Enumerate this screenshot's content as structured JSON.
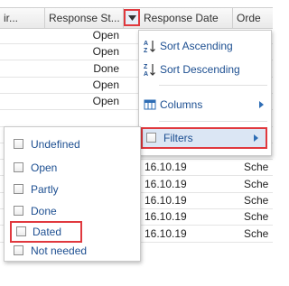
{
  "grid": {
    "columns": [
      "ir...",
      "Response St...",
      "Response Date",
      "Orde"
    ],
    "rows": [
      {
        "status": "Open",
        "date": "",
        "order": ""
      },
      {
        "status": "Open",
        "date": "",
        "order": ""
      },
      {
        "status": "Done",
        "date": "",
        "order": ""
      },
      {
        "status": "Open",
        "date": "",
        "order": ""
      },
      {
        "status": "Open",
        "date": "",
        "order": ""
      },
      {
        "status": "",
        "date": "",
        "order": ""
      },
      {
        "status": "",
        "date": "",
        "order": "Sche"
      },
      {
        "status": "",
        "date": "",
        "order": "Sche"
      },
      {
        "status": "",
        "date": "16.10.19",
        "order": "Sche"
      },
      {
        "status": "",
        "date": "16.10.19",
        "order": "Sche"
      },
      {
        "status": "",
        "date": "16.10.19",
        "order": "Sche"
      },
      {
        "status": "",
        "date": "16.10.19",
        "order": "Sche"
      },
      {
        "status": "",
        "date": "16.10.19",
        "order": "Sche"
      }
    ]
  },
  "column_menu": {
    "items": [
      {
        "label": "Sort Ascending",
        "icon": "sort-ascending-icon"
      },
      {
        "label": "Sort Descending",
        "icon": "sort-descending-icon"
      },
      {
        "label": "Columns",
        "icon": "columns-icon"
      },
      {
        "label": "Filters",
        "icon": "checkbox-icon"
      }
    ]
  },
  "filters_submenu": {
    "options": [
      {
        "label": "Undefined",
        "checked": false
      },
      {
        "label": "Open",
        "checked": false
      },
      {
        "label": "Partly",
        "checked": false
      },
      {
        "label": "Done",
        "checked": false
      },
      {
        "label": "Dated",
        "checked": false
      },
      {
        "label": "Not needed",
        "checked": false
      }
    ]
  },
  "colors": {
    "highlight_border": "#e0393e",
    "menu_text": "#1d4f91",
    "hover_bg": "#dbe6f4"
  }
}
